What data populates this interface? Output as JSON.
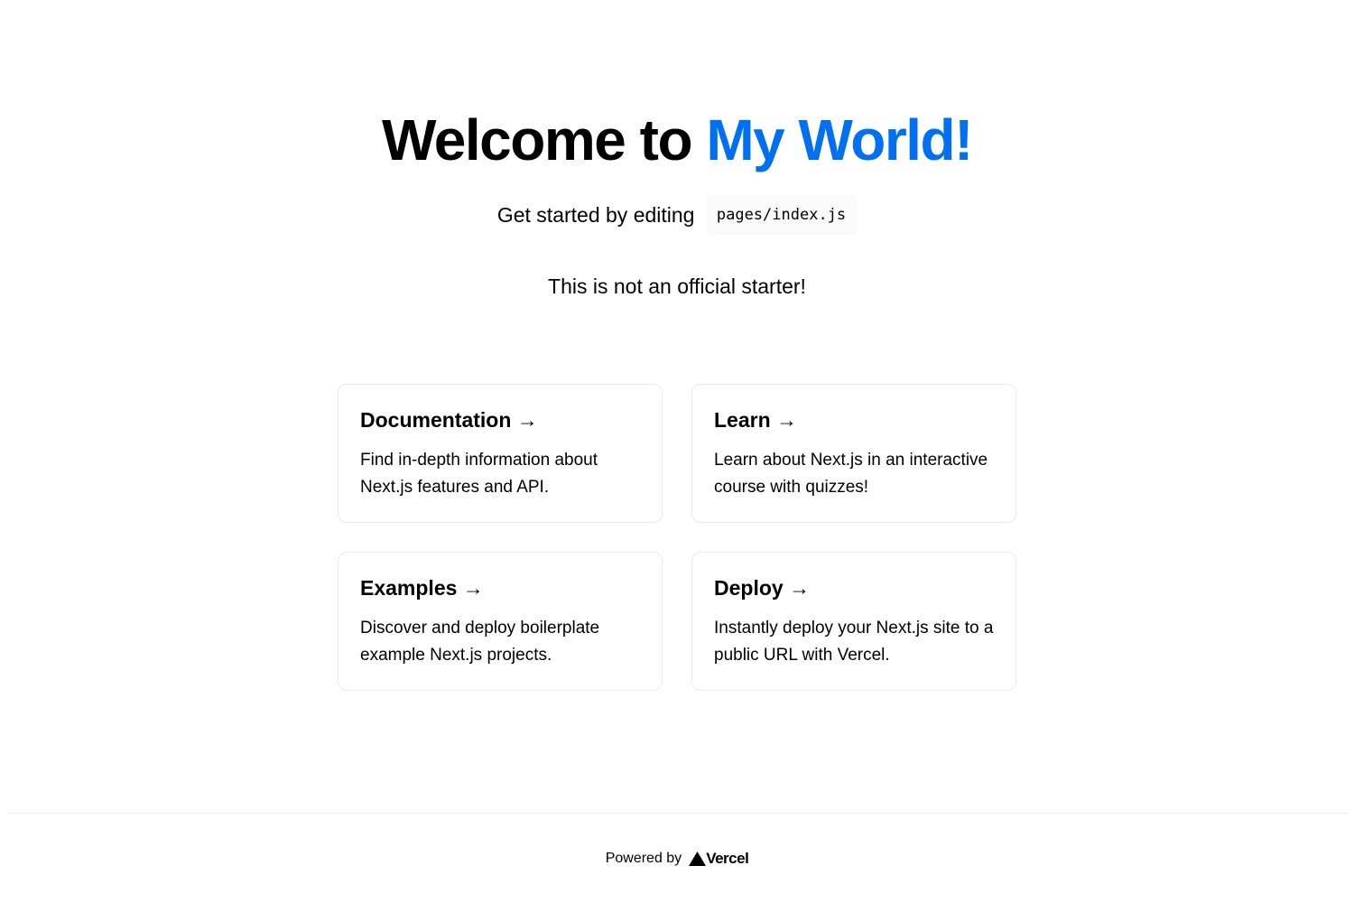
{
  "header": {
    "title_prefix": "Welcome to ",
    "title_accent": "My World!",
    "accent_color": "#0070f3"
  },
  "description": {
    "text": "Get started by editing",
    "code": "pages/index.js"
  },
  "note": "This is not an official starter!",
  "cards": [
    {
      "title": "Documentation →",
      "text": "Find in-depth information about Next.js features and API."
    },
    {
      "title": "Learn →",
      "text": "Learn about Next.js in an interactive course with quizzes!"
    },
    {
      "title": "Examples →",
      "text": "Discover and deploy boilerplate example Next.js projects."
    },
    {
      "title": "Deploy →",
      "text": "Instantly deploy your Next.js site to a public URL with Vercel."
    }
  ],
  "footer": {
    "powered_by": "Powered by",
    "logo_text": "Vercel",
    "logo_icon": "vercel-triangle-icon"
  }
}
